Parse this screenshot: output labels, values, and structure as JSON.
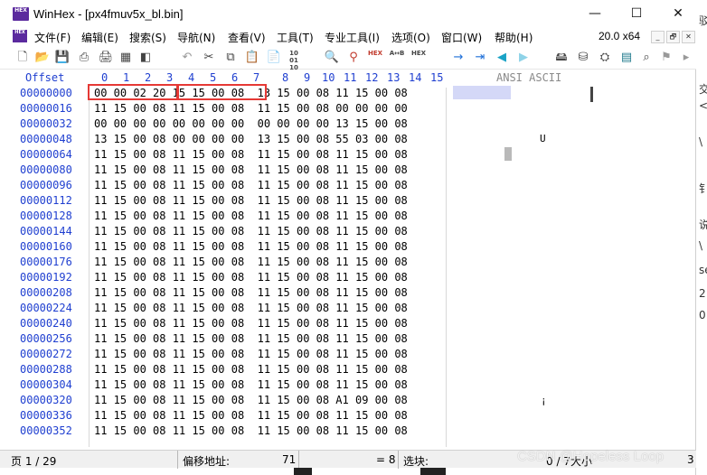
{
  "window": {
    "title": "WinHex - [px4fmuv5x_bl.bin]",
    "logo_text": "HEX",
    "controls": {
      "minimize": "—",
      "maximize": "☐",
      "close": "✕"
    }
  },
  "menu": {
    "items": [
      "文件(F)",
      "编辑(E)",
      "搜索(S)",
      "导航(N)",
      "查看(V)",
      "工具(T)",
      "专业工具(I)",
      "选项(O)",
      "窗口(W)",
      "帮助(H)"
    ],
    "version": "20.0 x64",
    "mdi_buttons": [
      "_",
      "🗗",
      "✕"
    ]
  },
  "toolbar": {
    "icons": [
      "new-file-icon",
      "open-file-icon",
      "save-icon",
      "print-icon",
      "properties-icon",
      "undo-icon",
      "cut-icon",
      "copy-icon",
      "paste-icon",
      "paste-write-icon",
      "hex-convert-icon",
      "find-icon",
      "find-hex-icon",
      "replace-icon",
      "replace-hex-icon",
      "goto-offset-icon",
      "goto-sector-icon",
      "back-icon",
      "forward-icon",
      "disk-icon",
      "ram-icon",
      "case-icon",
      "calculator-icon",
      "search-icon",
      "bookmark-icon",
      "flag-icon"
    ],
    "labels": {
      "hex": "HEX",
      "a_b": "A↔B",
      "binary": "10 01 10"
    }
  },
  "hex_view": {
    "offset_header": "Offset",
    "column_headers": [
      "0",
      "1",
      "2",
      "3",
      "4",
      "5",
      "6",
      "7",
      "8",
      "9",
      "10",
      "11",
      "12",
      "13",
      "14",
      "15"
    ],
    "ansi_header": "ANSI ASCII",
    "rows": [
      {
        "offset": "00000000",
        "bytes": "00 00 02 20 15 15 00 08 13 15 00 08 11 15 00 08"
      },
      {
        "offset": "00000016",
        "bytes": "11 15 00 08 11 15 00 08 11 15 00 08 00 00 00 00"
      },
      {
        "offset": "00000032",
        "bytes": "00 00 00 00 00 00 00 00 00 00 00 00 13 15 00 08"
      },
      {
        "offset": "00000048",
        "bytes": "13 15 00 08 00 00 00 00 13 15 00 08 55 03 00 08"
      },
      {
        "offset": "00000064",
        "bytes": "11 15 00 08 11 15 00 08 11 15 00 08 11 15 00 08"
      },
      {
        "offset": "00000080",
        "bytes": "11 15 00 08 11 15 00 08 11 15 00 08 11 15 00 08"
      },
      {
        "offset": "00000096",
        "bytes": "11 15 00 08 11 15 00 08 11 15 00 08 11 15 00 08"
      },
      {
        "offset": "00000112",
        "bytes": "11 15 00 08 11 15 00 08 11 15 00 08 11 15 00 08"
      },
      {
        "offset": "00000128",
        "bytes": "11 15 00 08 11 15 00 08 11 15 00 08 11 15 00 08"
      },
      {
        "offset": "00000144",
        "bytes": "11 15 00 08 11 15 00 08 11 15 00 08 11 15 00 08"
      },
      {
        "offset": "00000160",
        "bytes": "11 15 00 08 11 15 00 08 11 15 00 08 11 15 00 08"
      },
      {
        "offset": "00000176",
        "bytes": "11 15 00 08 11 15 00 08 11 15 00 08 11 15 00 08"
      },
      {
        "offset": "00000192",
        "bytes": "11 15 00 08 11 15 00 08 11 15 00 08 11 15 00 08"
      },
      {
        "offset": "00000208",
        "bytes": "11 15 00 08 11 15 00 08 11 15 00 08 11 15 00 08"
      },
      {
        "offset": "00000224",
        "bytes": "11 15 00 08 11 15 00 08 11 15 00 08 11 15 00 08"
      },
      {
        "offset": "00000240",
        "bytes": "11 15 00 08 11 15 00 08 11 15 00 08 11 15 00 08"
      },
      {
        "offset": "00000256",
        "bytes": "11 15 00 08 11 15 00 08 11 15 00 08 11 15 00 08"
      },
      {
        "offset": "00000272",
        "bytes": "11 15 00 08 11 15 00 08 11 15 00 08 11 15 00 08"
      },
      {
        "offset": "00000288",
        "bytes": "11 15 00 08 11 15 00 08 11 15 00 08 11 15 00 08"
      },
      {
        "offset": "00000304",
        "bytes": "11 15 00 08 11 15 00 08 11 15 00 08 11 15 00 08"
      },
      {
        "offset": "00000320",
        "bytes": "11 15 00 08 11 15 00 08 11 15 00 08 A1 09 00 08"
      },
      {
        "offset": "00000336",
        "bytes": "11 15 00 08 11 15 00 08 11 15 00 08 11 15 00 08"
      },
      {
        "offset": "00000352",
        "bytes": "11 15 00 08 11 15 00 08 11 15 00 08 11 15 00 08"
      }
    ],
    "ansi_chars": {
      "row48": "U",
      "row320": "¡"
    }
  },
  "status": {
    "page": "页 1 / 29",
    "offset_label": "偏移地址:",
    "offset_value": "71",
    "value_text": "= 8",
    "selection_label": "选块:",
    "size_text": "0 / 7大小",
    "size_value": "3"
  },
  "watermark": "CSDN @Hopeless Loop",
  "background_text": [
    "驳",
    "交",
    "<",
    "\\",
    "钅",
    "说",
    "\\",
    "se",
    "2",
    "0"
  ],
  "colors": {
    "offset_blue": "#1f3fd0",
    "highlight_red": "#e53935",
    "logo_purple": "#5b2a9e"
  }
}
